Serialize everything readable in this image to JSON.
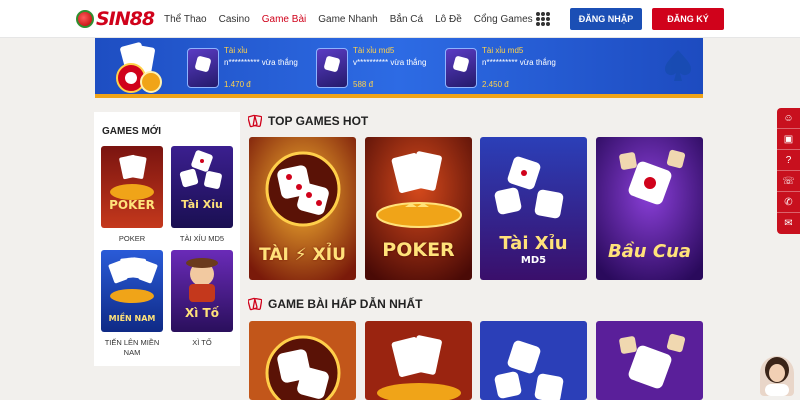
{
  "brand": {
    "logo_text": "SIN88"
  },
  "nav": {
    "items": [
      {
        "label": "Thể Thao",
        "active": false
      },
      {
        "label": "Casino",
        "active": false
      },
      {
        "label": "Game Bài",
        "active": true
      },
      {
        "label": "Game Nhanh",
        "active": false
      },
      {
        "label": "Bắn Cá",
        "active": false
      },
      {
        "label": "Lô Đề",
        "active": false
      },
      {
        "label": "Cổng Games",
        "active": false
      }
    ],
    "login_label": "ĐĂNG NHẬP",
    "register_label": "ĐĂNG KÝ"
  },
  "banner": {
    "winners": [
      {
        "game": "Tài xỉu",
        "user": "n********** vừa thắng",
        "amount": "1.470 đ"
      },
      {
        "game": "Tài xỉu md5",
        "user": "v********** vừa thắng",
        "amount": "588 đ"
      },
      {
        "game": "Tài xỉu md5",
        "user": "n********** vừa thắng",
        "amount": "2.450 đ"
      }
    ]
  },
  "sidebar": {
    "title": "GAMES MỚI",
    "games": [
      {
        "label": "POKER",
        "art_text": "POKER"
      },
      {
        "label": "TÀI XỈU MD5",
        "art_text": "Tài Xỉu"
      },
      {
        "label": "TIẾN LÊN MIỀN NAM",
        "art_text": "MIỀN NAM"
      },
      {
        "label": "XÌ TỐ",
        "art_text": "Xì Tố"
      }
    ]
  },
  "sections": {
    "top_hot": {
      "title": "TOP GAMES HOT",
      "cards": [
        {
          "art_text": "TÀI ⚡ XỈU"
        },
        {
          "art_text": "POKER"
        },
        {
          "art_text": "Tài Xỉu",
          "art_sub": "MD5"
        },
        {
          "art_text": "Bầu Cua"
        }
      ]
    },
    "card_games": {
      "title": "GAME BÀI HẤP DẪN NHẤT"
    }
  },
  "colors": {
    "brand_red": "#d0021b",
    "login_blue": "#1b4fb5",
    "banner_blue": "#2d6be4",
    "gold": "#f0a418"
  }
}
